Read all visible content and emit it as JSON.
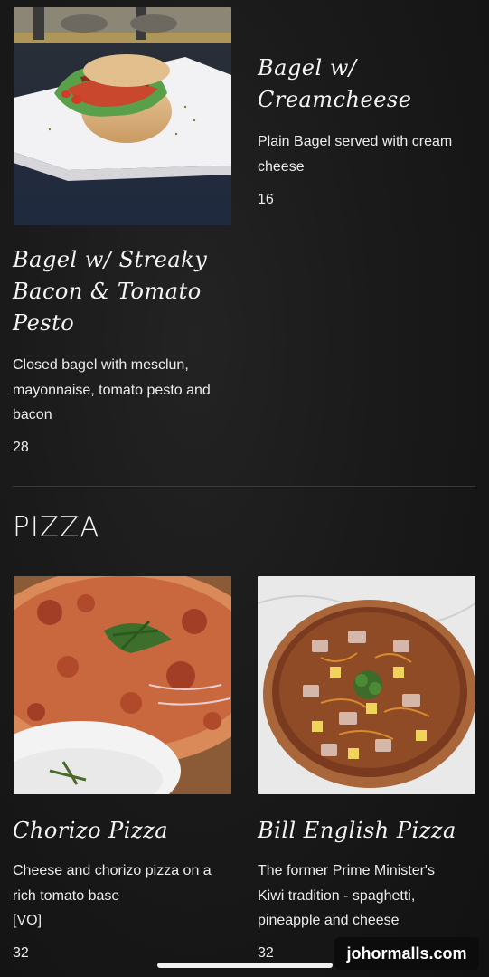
{
  "menu": {
    "items_top": [
      {
        "name": "Bagel w/ Streaky Bacon & Tomato Pesto",
        "name_lines": [
          "Bagel w/ Streaky",
          "Bacon & Tomato",
          "Pesto"
        ],
        "description_lines": [
          "Closed bagel with mesclun,",
          "mayonnaise, tomato pesto and",
          "bacon"
        ],
        "price": "28"
      },
      {
        "name": "Bagel w/ Creamcheese",
        "name_lines": [
          "Bagel w/",
          "Creamcheese"
        ],
        "description_lines": [
          "Plain Bagel served with cream",
          "cheese"
        ],
        "price": "16"
      }
    ],
    "pizza_section": {
      "title": "PIZZA",
      "items": [
        {
          "name": "Chorizo Pizza",
          "description_lines": [
            "Cheese and chorizo pizza on a",
            "rich tomato base",
            "[VO]"
          ],
          "price": "32"
        },
        {
          "name": "Bill English Pizza",
          "description_lines": [
            "The former Prime Minister's",
            "Kiwi tradition - spaghetti,",
            "pineapple and cheese"
          ],
          "price": "32"
        }
      ]
    }
  },
  "watermark": "johormalls.com",
  "icons": {
    "home_indicator": "home-indicator-bar"
  }
}
